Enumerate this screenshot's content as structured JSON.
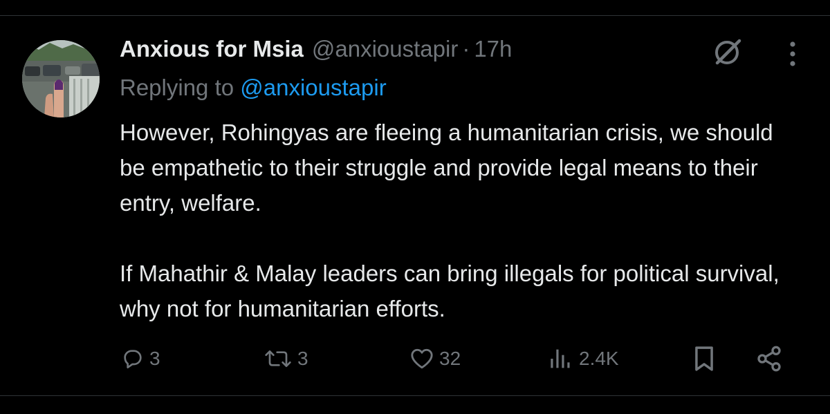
{
  "tweet": {
    "author": {
      "display_name": "Anxious for Msia",
      "handle": "@anxioustapir",
      "separator": "·",
      "time": "17h"
    },
    "replying": {
      "prefix": "Replying to ",
      "mention": "@anxioustapir"
    },
    "text": "However, Rohingyas are fleeing a humanitarian crisis, we should be empathetic to their struggle and provide legal means to their entry, welfare.\n\nIf Mahathir & Malay leaders can bring illegals for political survival, why not for humanitarian efforts.",
    "actions": {
      "replies": "3",
      "reposts": "3",
      "likes": "32",
      "views": "2.4K"
    }
  },
  "icons": {
    "grok": "grok-icon",
    "more": "more-vertical-icon",
    "reply": "reply-icon",
    "repost": "repost-icon",
    "like": "heart-icon",
    "views": "views-icon",
    "bookmark": "bookmark-icon",
    "share": "share-icon"
  },
  "colors": {
    "background": "#000000",
    "text": "#e7e9ea",
    "secondary": "#71767b",
    "link": "#1d9bf0",
    "divider": "#2f3336"
  }
}
